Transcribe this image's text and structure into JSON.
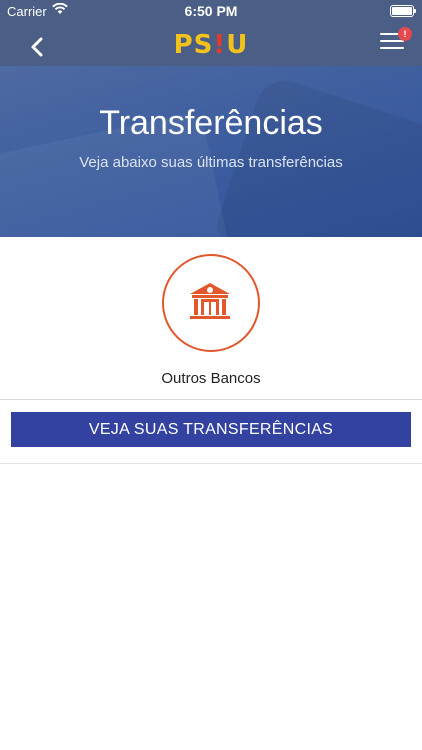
{
  "status_bar": {
    "carrier": "Carrier",
    "time": "6:50 PM",
    "wifi_icon": "wifi-icon",
    "battery_icon": "battery-icon"
  },
  "nav": {
    "back_icon": "chevron-left-icon",
    "logo_left": "PS",
    "logo_bang": "!",
    "logo_right": "U",
    "menu_icon": "hamburger-menu-icon",
    "notification_count": "!"
  },
  "hero": {
    "title": "Transferências",
    "subtitle": "Veja abaixo suas últimas transferências"
  },
  "bank_option": {
    "icon": "bank-icon",
    "label": "Outros Bancos"
  },
  "cta": {
    "label": "VEJA SUAS TRANSFERÊNCIAS"
  },
  "colors": {
    "nav_bg": "#4a5e86",
    "hero_bg": "#3f5f9f",
    "accent_orange": "#e1582c",
    "button_bg": "#3342a0",
    "logo_yellow": "#f2c21a",
    "badge_red": "#e5484d"
  }
}
